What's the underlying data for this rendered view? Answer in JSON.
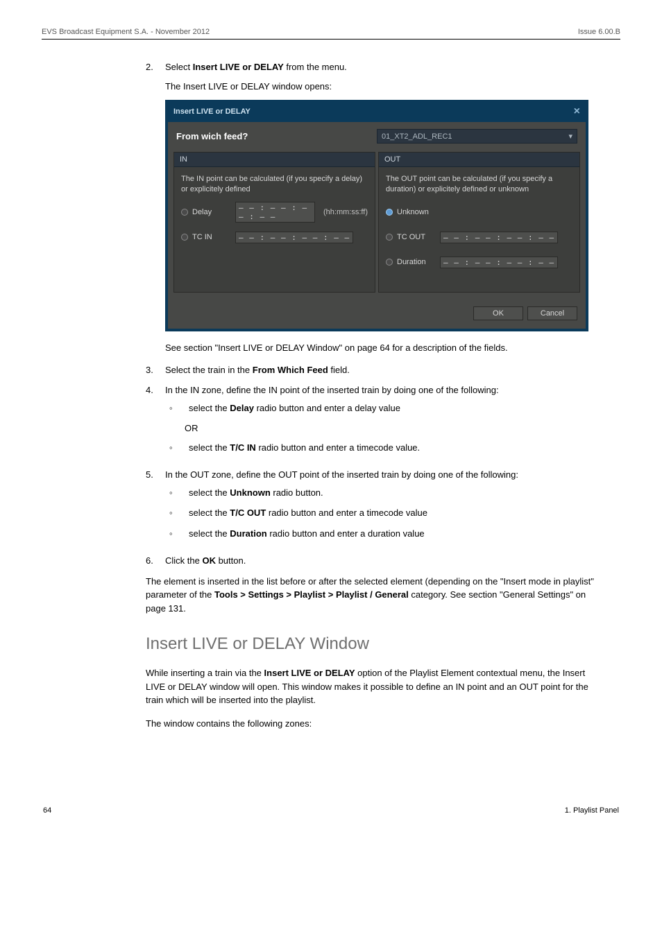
{
  "header": {
    "left": "EVS Broadcast Equipment S.A. - November 2012",
    "right": "Issue 6.00.B"
  },
  "step2": {
    "num": "2.",
    "line1_a": "Select ",
    "line1_b": "Insert LIVE or DELAY",
    "line1_c": " from the menu.",
    "sub": "The Insert LIVE or DELAY window opens:"
  },
  "dialog": {
    "title": "Insert LIVE or DELAY",
    "close": "×",
    "feed_label": "From wich feed?",
    "feed_value": "01_XT2_ADL_REC1",
    "caret": "▾",
    "in": {
      "hd": "IN",
      "desc": "The IN point can be calculated (if you specify a delay) or explicitely defined",
      "delay_label": "Delay",
      "delay_val": "– – : – – : – – : – –",
      "delay_suffix": "(hh:mm:ss:ff)",
      "tcin_label": "TC IN",
      "tcin_val": "– – : – – : – – : – –"
    },
    "out": {
      "hd": "OUT",
      "desc": "The OUT point can be calculated (if you specify a duration) or explicitely defined or unknown",
      "unknown_label": "Unknown",
      "tcout_label": "TC OUT",
      "tcout_val": "– – : – – : – – : – –",
      "dur_label": "Duration",
      "dur_val": "– – : – – : – – : – –"
    },
    "ok": "OK",
    "cancel": "Cancel"
  },
  "after_dlg": "See section \"Insert LIVE or DELAY Window\" on page 64 for a description of the fields.",
  "step3": {
    "num": "3.",
    "a": "Select the train in the ",
    "b": "From Which Feed",
    "c": " field."
  },
  "step4": {
    "num": "4.",
    "text": "In the IN zone, define the IN point of the inserted train by doing one of the following:",
    "opt1_a": "select the ",
    "opt1_b": "Delay",
    "opt1_c": " radio button and enter a delay value",
    "or": "OR",
    "opt2_a": "select the ",
    "opt2_b": "T/C IN",
    "opt2_c": " radio button and enter a timecode value."
  },
  "step5": {
    "num": "5.",
    "text": "In the OUT zone, define the OUT point of the inserted train by doing one of the following:",
    "o1_a": "select the ",
    "o1_b": "Unknown",
    "o1_c": " radio button.",
    "o2_a": "select the ",
    "o2_b": "T/C OUT",
    "o2_c": " radio button and enter a timecode value",
    "o3_a": "select the ",
    "o3_b": "Duration",
    "o3_c": " radio button and enter a duration value"
  },
  "step6": {
    "num": "6.",
    "a": "Click the ",
    "b": "OK",
    "c": " button."
  },
  "tail": {
    "a": "The element is inserted in the list before or after the selected element (depending on the \"Insert mode in playlist\" parameter of the ",
    "b": "Tools > Settings > Playlist > Playlist / General",
    "c": " category. See section \"General Settings\" on page 131."
  },
  "h2": "Insert LIVE or DELAY Window",
  "p1": {
    "a": "While inserting a train via the ",
    "b": "Insert LIVE or DELAY",
    "c": " option of the Playlist Element contextual menu, the Insert LIVE or DELAY window will open. This window makes it possible to define an IN point and an OUT point for the train which will be inserted into the playlist."
  },
  "p2": "The window contains the following zones:",
  "footer": {
    "left": "64",
    "right": "1. Playlist Panel"
  }
}
